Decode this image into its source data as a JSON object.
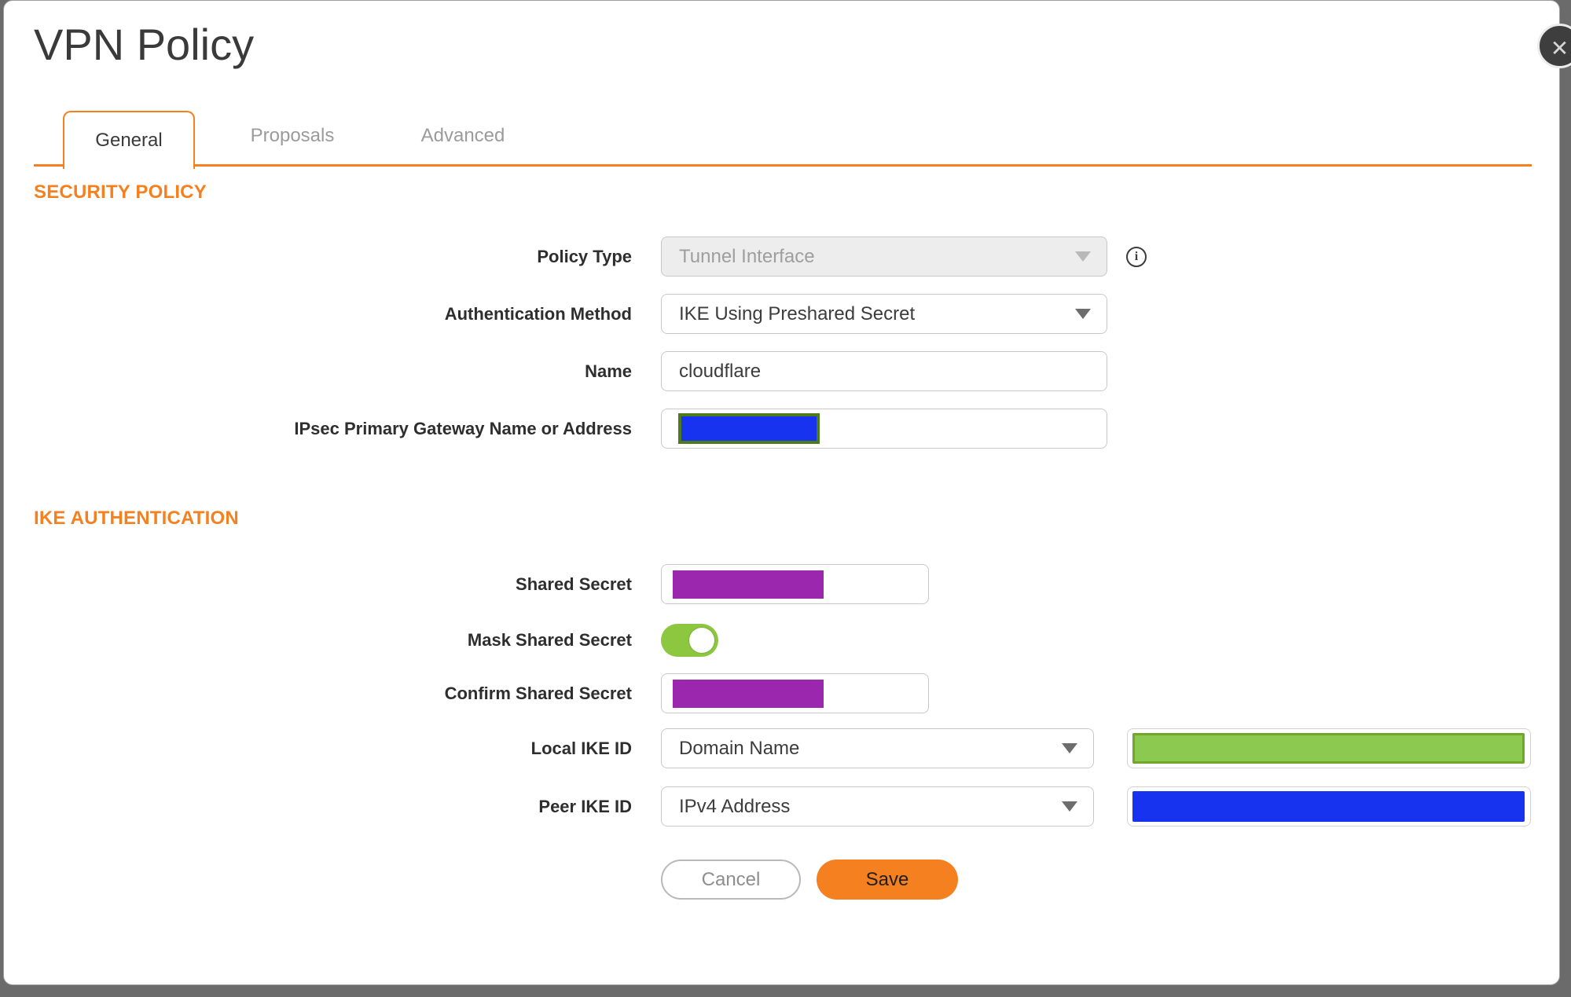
{
  "dialog": {
    "title": "VPN Policy"
  },
  "close_button": {
    "icon": "✕"
  },
  "tabs": [
    {
      "label": "General",
      "active": true
    },
    {
      "label": "Proposals",
      "active": false
    },
    {
      "label": "Advanced",
      "active": false
    }
  ],
  "security_policy_section": {
    "title": "SECURITY POLICY",
    "policy_type": {
      "label": "Policy Type",
      "value": "Tunnel Interface",
      "disabled": true,
      "info_icon": "i"
    },
    "authentication_method": {
      "label": "Authentication Method",
      "value": "IKE Using Preshared Secret"
    },
    "name": {
      "label": "Name",
      "value": "cloudflare"
    },
    "gateway": {
      "label": "IPsec Primary Gateway Name or Address",
      "value_redacted": true
    }
  },
  "ike_authentication_section": {
    "title": "IKE AUTHENTICATION",
    "shared_secret": {
      "label": "Shared Secret",
      "value_redacted": true
    },
    "mask_shared_secret": {
      "label": "Mask Shared Secret",
      "state": "on"
    },
    "confirm_shared_secret": {
      "label": "Confirm Shared Secret",
      "value_redacted": true
    },
    "local_ike_id": {
      "label": "Local IKE ID",
      "type": "Domain Name",
      "value_redacted": true
    },
    "peer_ike_id": {
      "label": "Peer IKE ID",
      "type": "IPv4 Address",
      "value_redacted": true
    }
  },
  "footer": {
    "cancel_label": "Cancel",
    "save_label": "Save"
  },
  "colors": {
    "accent_orange": "#F5801F",
    "toggle_green": "#8DC63F",
    "redact_purple": "#9B27AF",
    "redact_blue": "#1733F0",
    "redact_green_fill": "#8CC951",
    "redact_green_border": "#70A62A",
    "redact_olive_border": "#4E7A1E",
    "backdrop_gray": "#6B6B6B"
  }
}
